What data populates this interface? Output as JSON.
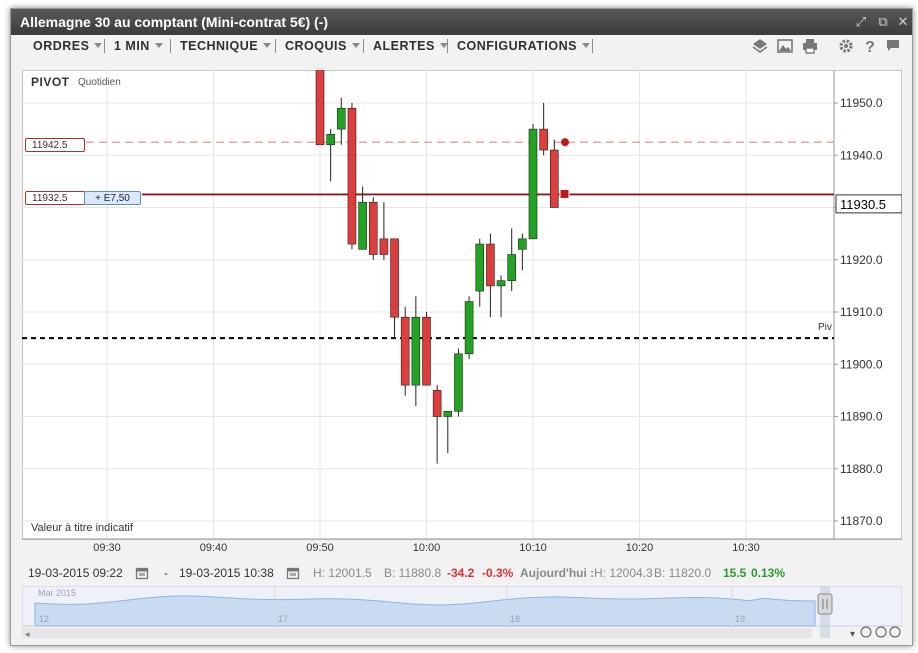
{
  "window": {
    "title": "Allemagne 30 au comptant (Mini-contrat 5€) (-)"
  },
  "toolbar": {
    "menus": [
      {
        "label": "ORDRES"
      },
      {
        "label": "1 MIN"
      },
      {
        "label": "TECHNIQUE"
      },
      {
        "label": "CROQUIS"
      },
      {
        "label": "ALERTES"
      },
      {
        "label": "CONFIGURATIONS"
      }
    ],
    "icons": [
      "layers-icon",
      "image-icon",
      "print-icon",
      "gear-icon",
      "help-icon",
      "comment-icon"
    ]
  },
  "chart": {
    "pivot_label": "PIVOT",
    "pivot_period": "Quotidien",
    "pivot_short": "Piv",
    "disclaimer": "Valeur à titre indicatif",
    "order_level": "11942.5",
    "position_level": "11932.5",
    "position_pl": "+ E7,50",
    "current_price": "11930.5",
    "colors": {
      "up": "#22a322",
      "down": "#dd3d3d",
      "level_line": "#8b1a1a",
      "order_line": "#e08a8a",
      "pivot": "#000000"
    }
  },
  "chart_data": {
    "type": "candlestick",
    "y_ticks": [
      "11950.0",
      "11940.0",
      "11930.0",
      "11920.0",
      "11910.0",
      "11900.0",
      "11890.0",
      "11880.0",
      "11870.0"
    ],
    "x_ticks": [
      "09:30",
      "09:40",
      "09:50",
      "10:00",
      "10:10",
      "10:20",
      "10:30"
    ],
    "ylim": [
      11867,
      11956
    ],
    "pivot": 11905,
    "candles": [
      {
        "t": "09:50",
        "o": 11958,
        "h": 11958,
        "l": 11942,
        "c": 11942
      },
      {
        "t": "09:51",
        "o": 11942,
        "h": 11945,
        "l": 11935,
        "c": 11944
      },
      {
        "t": "09:52",
        "o": 11945,
        "h": 11951,
        "l": 11942,
        "c": 11949
      },
      {
        "t": "09:53",
        "o": 11949,
        "h": 11950,
        "l": 11922,
        "c": 11923
      },
      {
        "t": "09:54",
        "o": 11922,
        "h": 11934,
        "l": 11922,
        "c": 11931
      },
      {
        "t": "09:55",
        "o": 11931,
        "h": 11932,
        "l": 11920,
        "c": 11921
      },
      {
        "t": "09:56",
        "o": 11924,
        "h": 11931,
        "l": 11920,
        "c": 11921
      },
      {
        "t": "09:57",
        "o": 11924,
        "h": 11924,
        "l": 11905,
        "c": 11909
      },
      {
        "t": "09:58",
        "o": 11909,
        "h": 11911,
        "l": 11894,
        "c": 11896
      },
      {
        "t": "09:59",
        "o": 11896,
        "h": 11913,
        "l": 11892,
        "c": 11909
      },
      {
        "t": "10:00",
        "o": 11909,
        "h": 11910,
        "l": 11896,
        "c": 11896
      },
      {
        "t": "10:01",
        "o": 11895,
        "h": 11896,
        "l": 11881,
        "c": 11890
      },
      {
        "t": "10:02",
        "o": 11890,
        "h": 11891,
        "l": 11883,
        "c": 11891
      },
      {
        "t": "10:03",
        "o": 11891,
        "h": 11903,
        "l": 11890,
        "c": 11902
      },
      {
        "t": "10:04",
        "o": 11902,
        "h": 11913,
        "l": 11901,
        "c": 11912
      },
      {
        "t": "10:05",
        "o": 11914,
        "h": 11924,
        "l": 11911,
        "c": 11923
      },
      {
        "t": "10:06",
        "o": 11923,
        "h": 11925,
        "l": 11909,
        "c": 11915
      },
      {
        "t": "10:07",
        "o": 11915,
        "h": 11917,
        "l": 11909,
        "c": 11916
      },
      {
        "t": "10:08",
        "o": 11916,
        "h": 11926,
        "l": 11914,
        "c": 11921
      },
      {
        "t": "10:09",
        "o": 11922,
        "h": 11925,
        "l": 11918,
        "c": 11924
      },
      {
        "t": "10:10",
        "o": 11924,
        "h": 11946,
        "l": 11924,
        "c": 11945
      },
      {
        "t": "10:11",
        "o": 11945,
        "h": 11950,
        "l": 11940,
        "c": 11941
      },
      {
        "t": "10:12",
        "o": 11941,
        "h": 11943,
        "l": 11930,
        "c": 11930
      }
    ]
  },
  "status": {
    "start_date": "19-03-2015 09:22",
    "dash": "-",
    "end_date": "19-03-2015 10:38",
    "range_h": "H: 12001.5",
    "range_b": "B: 11880.8",
    "range_change": "-34.2",
    "range_change_pct": "-0.3%",
    "today_label": "Aujourd'hui :",
    "today_h": "H: 12004.3",
    "today_b": "B: 11820.0",
    "today_change": "15.5",
    "today_change_pct": "0.13%"
  },
  "navigator": {
    "month_label": "Mar 2015",
    "day_labels": [
      "12",
      "17",
      "18",
      "19"
    ]
  }
}
